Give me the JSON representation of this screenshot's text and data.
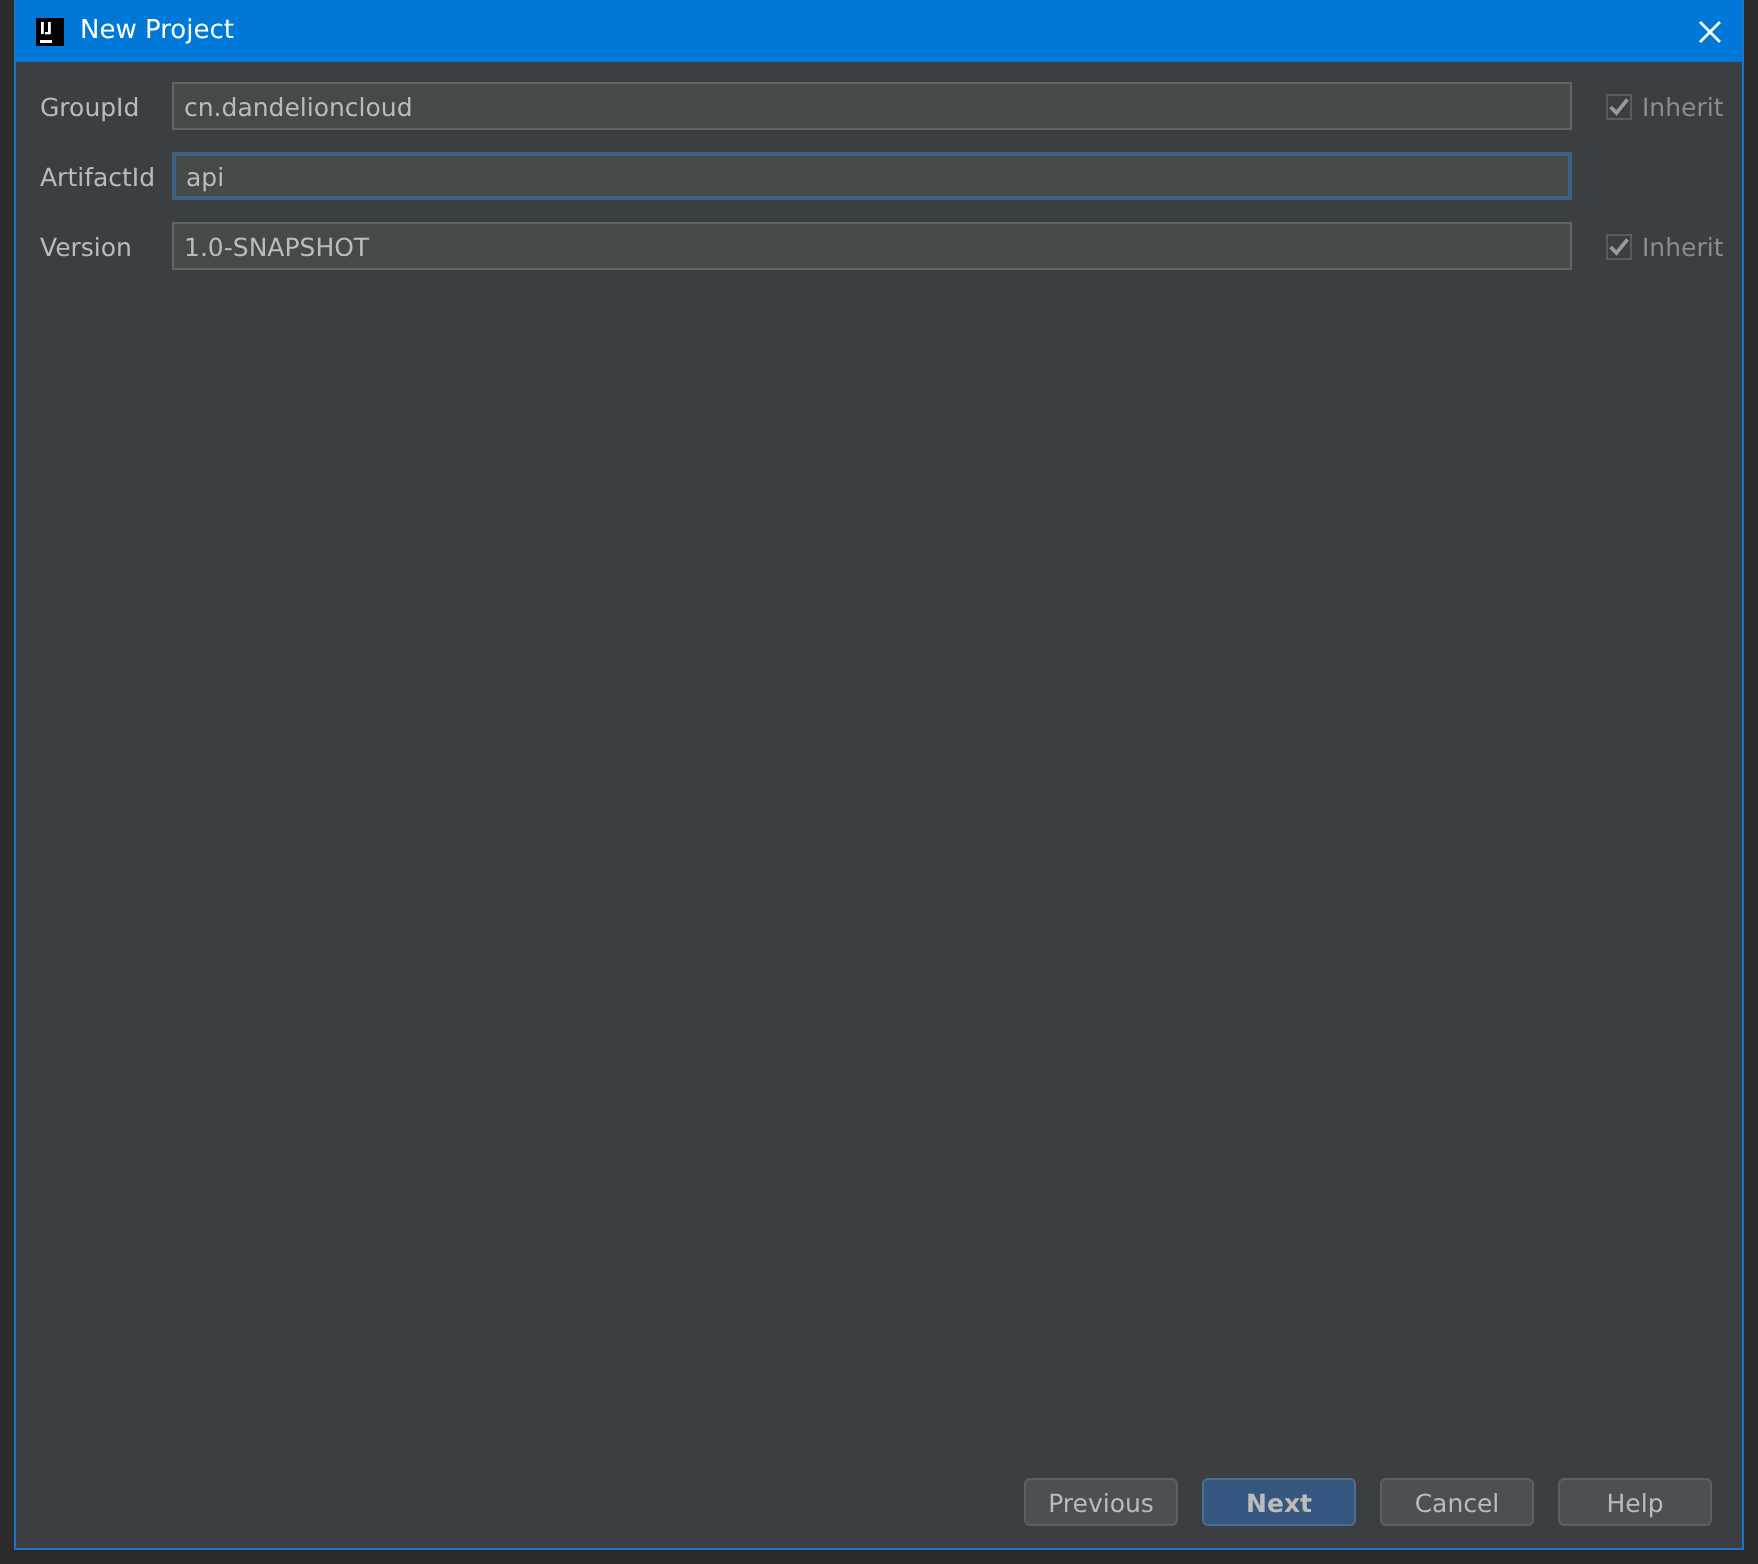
{
  "window": {
    "title": "New Project"
  },
  "fields": [
    {
      "label": "GroupId",
      "value": "cn.dandelioncloud",
      "focused": false,
      "inherit": {
        "label": "Inherit",
        "checked": true,
        "disabled": true
      }
    },
    {
      "label": "ArtifactId",
      "value": "api",
      "focused": true
    },
    {
      "label": "Version",
      "value": "1.0-SNAPSHOT",
      "focused": false,
      "inherit": {
        "label": "Inherit",
        "checked": true,
        "disabled": true
      }
    }
  ],
  "buttons": [
    {
      "label": "Previous",
      "default": false
    },
    {
      "label": "Next",
      "default": true
    },
    {
      "label": "Cancel",
      "default": false
    },
    {
      "label": "Help",
      "default": false
    }
  ]
}
